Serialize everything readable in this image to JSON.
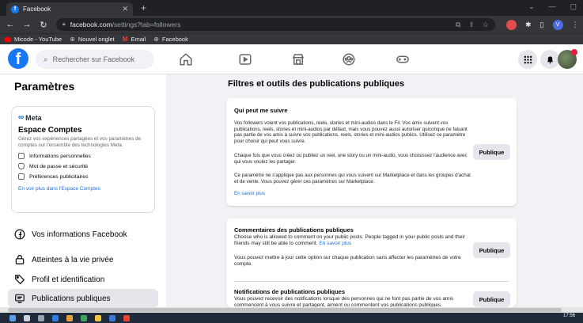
{
  "browser": {
    "tab_title": "Facebook",
    "url_domain": "facebook.com",
    "url_path": "/settings?tab=followers",
    "bookmarks": [
      {
        "label": "Micode - YouTube"
      },
      {
        "label": "Nouvel onglet"
      },
      {
        "label": "Email"
      },
      {
        "label": "Facebook"
      }
    ]
  },
  "header": {
    "logo": "f",
    "search_placeholder": "Rechercher sur Facebook"
  },
  "sidebar": {
    "title": "Paramètres",
    "meta_logo": "Meta",
    "account_center": {
      "title": "Espace Comptes",
      "description": "Gérez vos expériences partagées et vos paramètres de comptes sur l'ensemble des technologies Meta.",
      "items": [
        {
          "label": "Informations personnelles"
        },
        {
          "label": "Mot de passe et sécurité"
        },
        {
          "label": "Préférences publicitaires"
        }
      ],
      "link": "En voir plus dans l'Espace Comptes"
    },
    "items": [
      {
        "label": "Vos informations Facebook"
      },
      {
        "label": "Atteintes à la vie privée"
      },
      {
        "label": "Profil et identification"
      },
      {
        "label": "Publications publiques"
      }
    ]
  },
  "main": {
    "title": "Filtres et outils des publications publiques",
    "sections": [
      {
        "title": "Qui peut me suivre",
        "paragraphs": [
          "Vos followers voient vos publications, reels, stories et mini-audios dans le Fil. Vos amis suivent vos publications, reels, stories et mini-audios par défaut, mais vous pouvez aussi autoriser quiconque ne faisant pas partie de vos amis à suivre vos publications, reels, stories et mini-audios publics. Utilisez ce paramètre pour choisir qui peut vous suivre.",
          "Chaque fois que vous créez ou publiez un reel, une story ou un mini-audio, vous choisissez l'audience avec qui vous voulez les partager.",
          "Ce paramètre ne s'applique pas aux personnes qui vous suivent sur Marketplace et dans les groupes d'achat et de vente. Vous pouvez gérer ces paramètres sur Marketplace."
        ],
        "link": "En savoir plus",
        "button": "Publique"
      },
      {
        "title": "Commentaires des publications publiques",
        "paragraphs": [
          "Choose who is allowed to comment on your public posts. People tagged in your public posts and their friends may still be able to comment.",
          "Vous pouvez mettre à jour cette option sur chaque publication sans affecter les paramètres de votre compte."
        ],
        "link": "En savoir plus",
        "button": "Publique"
      },
      {
        "title": "Notifications de publications publiques",
        "paragraphs": [
          "Vous pouvez recevoir des notifications lorsque des personnes qui ne font pas partie de vos amis commencent à vous suivre et partagent, aiment ou commentent vos publications publiques."
        ],
        "button": "Publique"
      }
    ]
  },
  "taskbar": {
    "time": "17:56"
  },
  "colors": {
    "facebook_blue": "#1877f2",
    "link_blue": "#216fdb",
    "page_bg": "#f0f2f5"
  }
}
